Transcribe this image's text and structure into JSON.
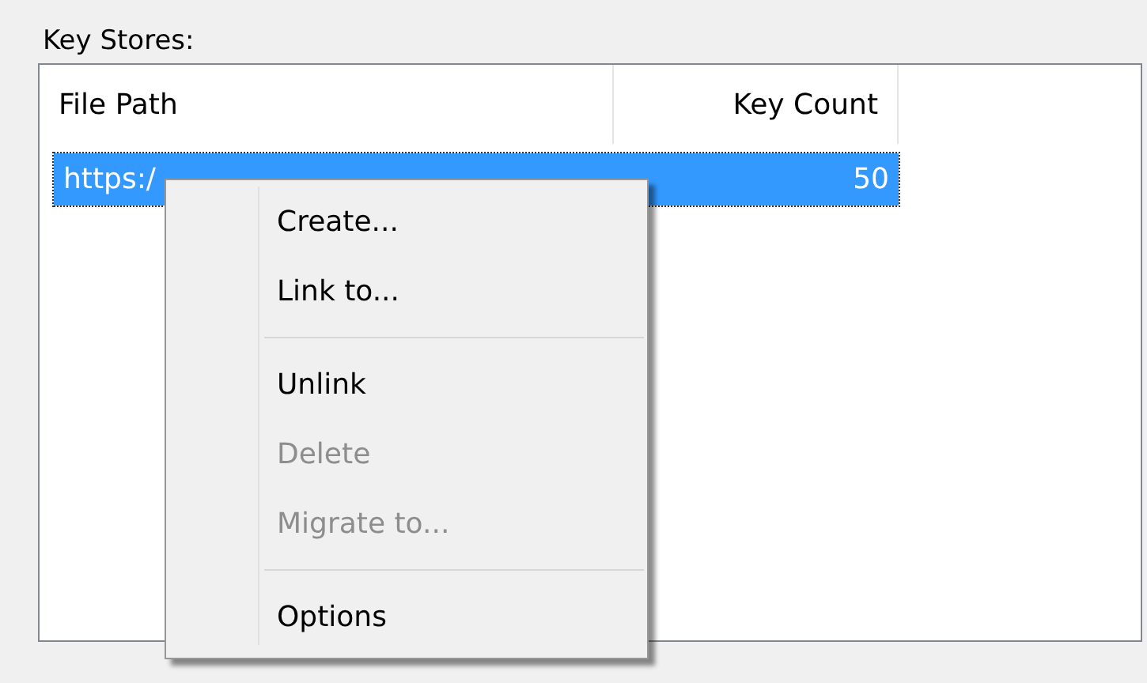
{
  "group_label": "Key Stores:",
  "table": {
    "columns": [
      {
        "label": "File Path"
      },
      {
        "label": "Key Count"
      }
    ],
    "rows": [
      {
        "file_path": "https:/",
        "key_count": "50",
        "selected": true
      }
    ]
  },
  "context_menu": {
    "items": [
      {
        "kind": "item",
        "label": "Create...",
        "disabled": false
      },
      {
        "kind": "item",
        "label": "Link to...",
        "disabled": false
      },
      {
        "kind": "separator"
      },
      {
        "kind": "item",
        "label": "Unlink",
        "disabled": false
      },
      {
        "kind": "item",
        "label": "Delete",
        "disabled": true
      },
      {
        "kind": "item",
        "label": "Migrate to...",
        "disabled": true
      },
      {
        "kind": "separator"
      },
      {
        "kind": "item",
        "label": "Options",
        "disabled": false
      }
    ]
  }
}
